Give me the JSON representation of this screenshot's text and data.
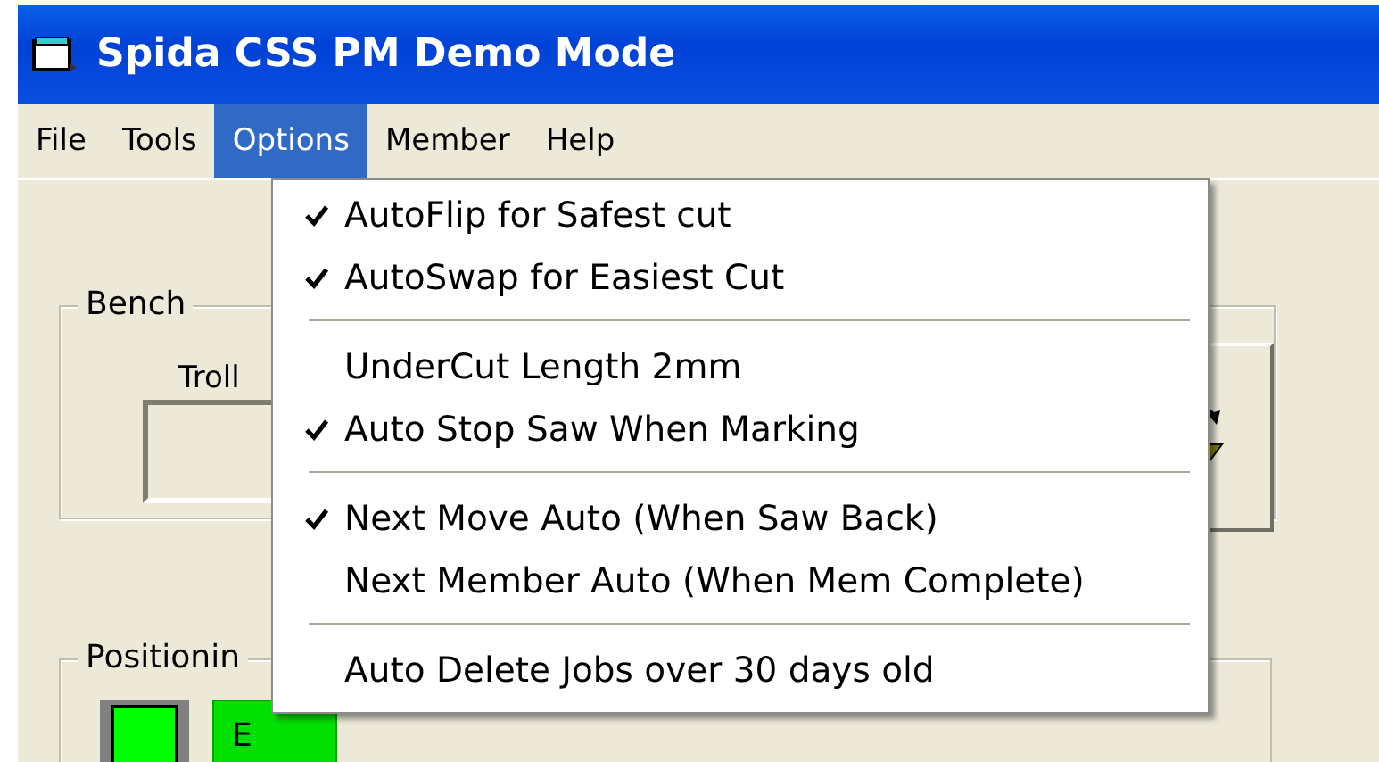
{
  "window": {
    "title": "Spida CSS PM Demo Mode"
  },
  "menubar": [
    {
      "label": "File",
      "selected": false
    },
    {
      "label": "Tools",
      "selected": false
    },
    {
      "label": "Options",
      "selected": true
    },
    {
      "label": "Member",
      "selected": false
    },
    {
      "label": "Help",
      "selected": false
    }
  ],
  "options_menu": {
    "items": [
      {
        "kind": "item",
        "label": "AutoFlip for Safest cut",
        "checked": true
      },
      {
        "kind": "item",
        "label": "AutoSwap for Easiest Cut",
        "checked": true
      },
      {
        "kind": "separator"
      },
      {
        "kind": "item",
        "label": "UnderCut Length 2mm",
        "checked": false
      },
      {
        "kind": "item",
        "label": "Auto Stop Saw When Marking",
        "checked": true
      },
      {
        "kind": "separator"
      },
      {
        "kind": "item",
        "label": "Next Move Auto (When Saw Back)",
        "checked": true
      },
      {
        "kind": "item",
        "label": "Next Member Auto (When Mem Complete)",
        "checked": false
      },
      {
        "kind": "separator"
      },
      {
        "kind": "item",
        "label": "Auto Delete Jobs over 30 days old",
        "checked": false
      }
    ]
  },
  "bench": {
    "label": "Bench",
    "trolley_label": "Troll"
  },
  "positioning": {
    "label": "Positionin",
    "button_label": "E"
  }
}
